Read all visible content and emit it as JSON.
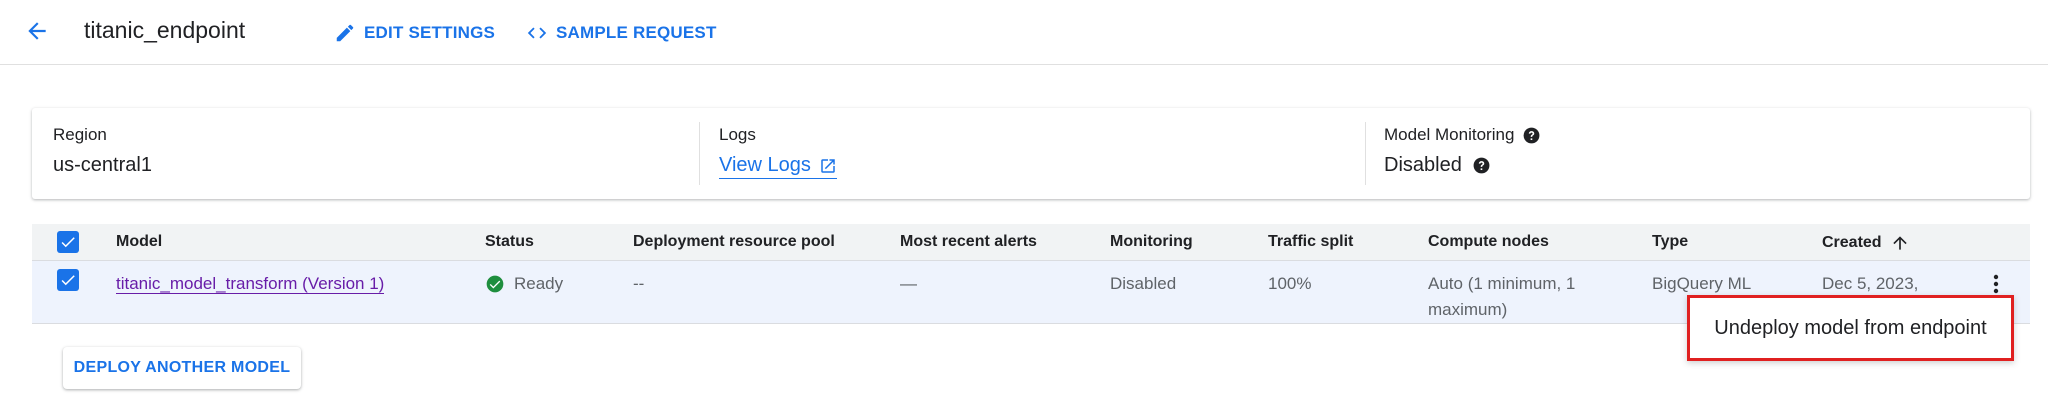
{
  "header": {
    "title": "titanic_endpoint",
    "edit_settings": "EDIT SETTINGS",
    "sample_request": "SAMPLE REQUEST"
  },
  "info": {
    "region_label": "Region",
    "region_value": "us-central1",
    "logs_label": "Logs",
    "logs_link": "View Logs",
    "monitoring_label": "Model Monitoring",
    "monitoring_value": "Disabled"
  },
  "table": {
    "columns": [
      "Model",
      "Status",
      "Deployment resource pool",
      "Most recent alerts",
      "Monitoring",
      "Traffic split",
      "Compute nodes",
      "Type",
      "Created"
    ],
    "row": {
      "model": "titanic_model_transform (Version 1)",
      "status": "Ready",
      "pool": "--",
      "alerts": "—",
      "monitoring": "Disabled",
      "traffic": "100%",
      "compute": "Auto (1 minimum, 1 maximum)",
      "type": "BigQuery ML",
      "created": "Dec 5, 2023,"
    }
  },
  "deploy_button": "DEPLOY ANOTHER MODEL",
  "context_menu": {
    "undeploy": "Undeploy model from endpoint"
  },
  "colors": {
    "accent": "#1a73e8",
    "link_visited": "#681da8",
    "ready": "#1e8e3e",
    "highlight": "#e02020"
  }
}
